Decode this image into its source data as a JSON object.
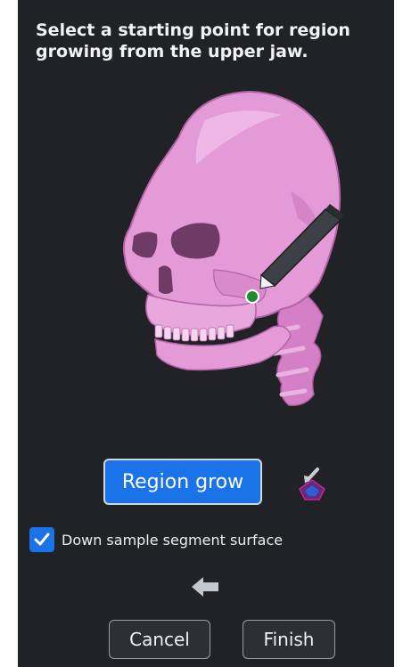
{
  "instruction": "Select a starting point for region growing from the upper jaw.",
  "viewport": {
    "model": "skull-3d-model",
    "model_color": "#e39ad7",
    "seed_color": "#1e8c2e",
    "tool": "pencil-cursor-icon"
  },
  "region_grow": {
    "label": "Region grow",
    "color": "#1a73e8",
    "icon": "seed-point-icon"
  },
  "options": {
    "down_sample_label": "Down sample segment surface",
    "down_sample_checked": true
  },
  "back_icon": "back-arrow-icon",
  "buttons": {
    "cancel": "Cancel",
    "finish": "Finish"
  },
  "colors": {
    "panel_background": "#202225",
    "accent": "#1a73e8"
  }
}
